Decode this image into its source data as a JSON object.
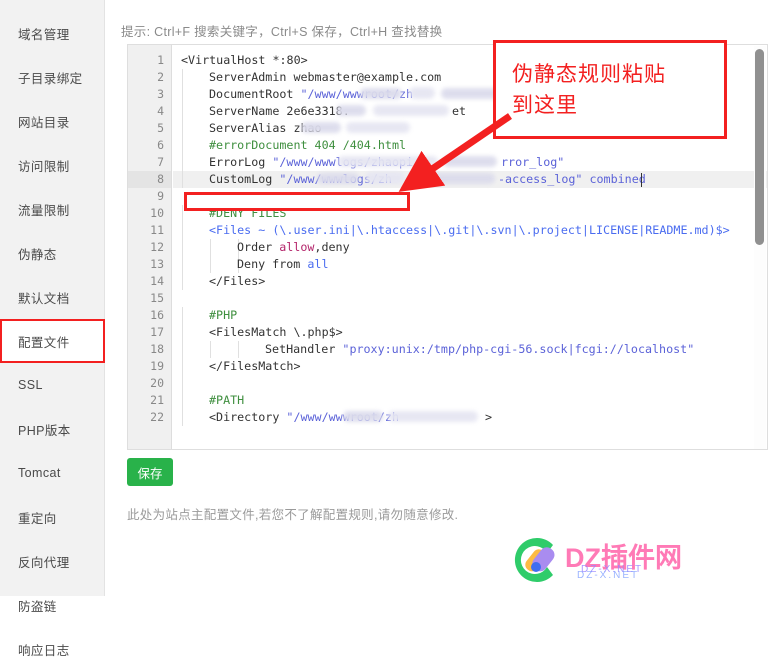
{
  "sidebar": {
    "items": [
      {
        "label": "域名管理",
        "selected": false
      },
      {
        "label": "子目录绑定",
        "selected": false
      },
      {
        "label": "网站目录",
        "selected": false
      },
      {
        "label": "访问限制",
        "selected": false
      },
      {
        "label": "流量限制",
        "selected": false
      },
      {
        "label": "伪静态",
        "selected": false
      },
      {
        "label": "默认文档",
        "selected": false
      },
      {
        "label": "配置文件",
        "selected": true
      },
      {
        "label": "SSL",
        "selected": false
      },
      {
        "label": "PHP版本",
        "selected": false
      },
      {
        "label": "Tomcat",
        "selected": false
      },
      {
        "label": "重定向",
        "selected": false
      },
      {
        "label": "反向代理",
        "selected": false
      },
      {
        "label": "防盗链",
        "selected": false
      },
      {
        "label": "响应日志",
        "selected": false
      }
    ]
  },
  "hint": "提示: Ctrl+F 搜索关键字，Ctrl+S 保存，Ctrl+H 查找替换",
  "editor": {
    "active_line": 8,
    "line_numbers": [
      1,
      2,
      3,
      4,
      5,
      6,
      7,
      8,
      9,
      10,
      11,
      12,
      13,
      14,
      15,
      16,
      17,
      18,
      19,
      20,
      21,
      22
    ],
    "lines": [
      {
        "n": 1,
        "indent": 0,
        "tokens": [
          {
            "t": "<VirtualHost *:80>",
            "c": "def"
          }
        ]
      },
      {
        "n": 2,
        "indent": 1,
        "tokens": [
          {
            "t": "ServerAdmin webmaster@example.com",
            "c": "def"
          }
        ]
      },
      {
        "n": 3,
        "indent": 1,
        "tokens": [
          {
            "t": "DocumentRoot ",
            "c": "def"
          },
          {
            "t": "\"/www/wwwroot/zh",
            "c": "str"
          }
        ]
      },
      {
        "n": 4,
        "indent": 1,
        "tokens": [
          {
            "t": "ServerName 2e6e3318.",
            "c": "def"
          }
        ]
      },
      {
        "n": 5,
        "indent": 1,
        "tokens": [
          {
            "t": "ServerAlias zhao",
            "c": "def"
          }
        ]
      },
      {
        "n": 6,
        "indent": 1,
        "tokens": [
          {
            "t": "#errorDocument 404 /404.html",
            "c": "cmt"
          }
        ]
      },
      {
        "n": 7,
        "indent": 1,
        "tokens": [
          {
            "t": "ErrorLog ",
            "c": "def"
          },
          {
            "t": "\"/www/wwwlogs/zhaopi",
            "c": "str"
          }
        ]
      },
      {
        "n": 8,
        "indent": 1,
        "tokens": [
          {
            "t": "CustomLog ",
            "c": "def"
          },
          {
            "t": "\"/www/wwwlogs/zh",
            "c": "str"
          }
        ]
      },
      {
        "n": 9,
        "indent": 0,
        "tokens": []
      },
      {
        "n": 10,
        "indent": 1,
        "tokens": [
          {
            "t": "#DENY FILES",
            "c": "cmt"
          }
        ]
      },
      {
        "n": 11,
        "indent": 1,
        "tokens": [
          {
            "t": "<Files ~ (\\.user.ini|\\.htaccess|\\.git|\\.svn|\\.project|LICENSE|README.md)$>",
            "c": "blue"
          }
        ]
      },
      {
        "n": 12,
        "indent": 2,
        "tokens": [
          {
            "t": "Order ",
            "c": "def"
          },
          {
            "t": "allow",
            "c": "kw"
          },
          {
            "t": ",deny",
            "c": "def"
          }
        ]
      },
      {
        "n": 13,
        "indent": 2,
        "tokens": [
          {
            "t": "Deny from ",
            "c": "def"
          },
          {
            "t": "all",
            "c": "blue"
          }
        ]
      },
      {
        "n": 14,
        "indent": 1,
        "tokens": [
          {
            "t": "</Files>",
            "c": "def"
          }
        ]
      },
      {
        "n": 15,
        "indent": 0,
        "tokens": []
      },
      {
        "n": 16,
        "indent": 1,
        "tokens": [
          {
            "t": "#PHP",
            "c": "cmt"
          }
        ]
      },
      {
        "n": 17,
        "indent": 1,
        "tokens": [
          {
            "t": "<FilesMatch \\.php$>",
            "c": "def"
          }
        ]
      },
      {
        "n": 18,
        "indent": 3,
        "tokens": [
          {
            "t": "SetHandler ",
            "c": "def"
          },
          {
            "t": "\"proxy:unix:/tmp/php-cgi-56.sock|fcgi://localhost\"",
            "c": "str"
          }
        ]
      },
      {
        "n": 19,
        "indent": 1,
        "tokens": [
          {
            "t": "</FilesMatch>",
            "c": "def"
          }
        ]
      },
      {
        "n": 20,
        "indent": 0,
        "tokens": []
      },
      {
        "n": 21,
        "indent": 1,
        "tokens": [
          {
            "t": "#PATH",
            "c": "cmt"
          }
        ]
      },
      {
        "n": 22,
        "indent": 1,
        "tokens": [
          {
            "t": "<Directory ",
            "c": "def"
          },
          {
            "t": "\"/www/wwwroot/zh",
            "c": "str"
          }
        ]
      }
    ],
    "trailing": {
      "line7_suffix": "rror_log\"",
      "line8_suffix": "-access_log\" combined",
      "line4_suffix": "et",
      "line22_suffix": ">"
    }
  },
  "save_button": {
    "label": "保存"
  },
  "footer_note": "此处为站点主配置文件,若您不了解配置规则,请勿随意修改.",
  "annotation": {
    "callout_line1": "伪静态规则粘贴",
    "callout_line2": "到这里",
    "color": "#f32020"
  },
  "watermark": {
    "text": "DZ插件网",
    "sub": "DZ-X.NET",
    "sub2": "DZ-X.NET"
  }
}
